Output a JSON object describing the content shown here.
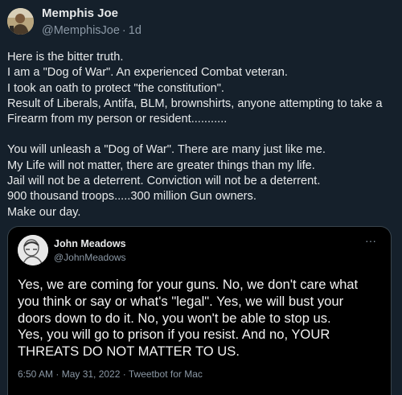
{
  "post": {
    "author_name": "Memphis Joe",
    "handle": "@MemphisJoe",
    "separator": "·",
    "time_ago": "1d",
    "paragraph1": [
      "Here is the bitter truth.",
      "I am a \"Dog of War\". An experienced Combat veteran.",
      "I took an oath to protect \"the constitution\".",
      "Result of Liberals, Antifa, BLM, brownshirts, anyone attempting to take a",
      "Firearm from my person or resident..........."
    ],
    "paragraph2": [
      "You will unleash a \"Dog of War\". There are many just like me.",
      "My Life will not matter, there are greater things than my life.",
      "Jail will not be a deterrent. Conviction will not be a deterrent.",
      "900 thousand troops.....300 million Gun owners.",
      "Make our day."
    ]
  },
  "quoted": {
    "author_name": "John Meadows",
    "handle": "@JohnMeadows",
    "more_icon": "···",
    "body": [
      "Yes, we are coming for your guns. No, we don't care what",
      "you think or say or what's \"legal\". Yes, we will bust your",
      "doors down to do it. No, you won't be able to stop us.",
      "Yes, you will go to prison if you resist. And no, YOUR",
      "THREATS DO NOT MATTER TO US."
    ],
    "footer": "6:50 AM · May 31, 2022 · Tweetbot for Mac"
  },
  "colors": {
    "background": "#15202b",
    "quote_background": "#000000",
    "text": "#e7e9ea",
    "secondary_text": "#8b98a5",
    "border": "#38444d"
  },
  "icons": {
    "author_avatar": "user-avatar-photo",
    "quoted_avatar": "user-avatar-sketch",
    "more": "more-horizontal-icon"
  }
}
